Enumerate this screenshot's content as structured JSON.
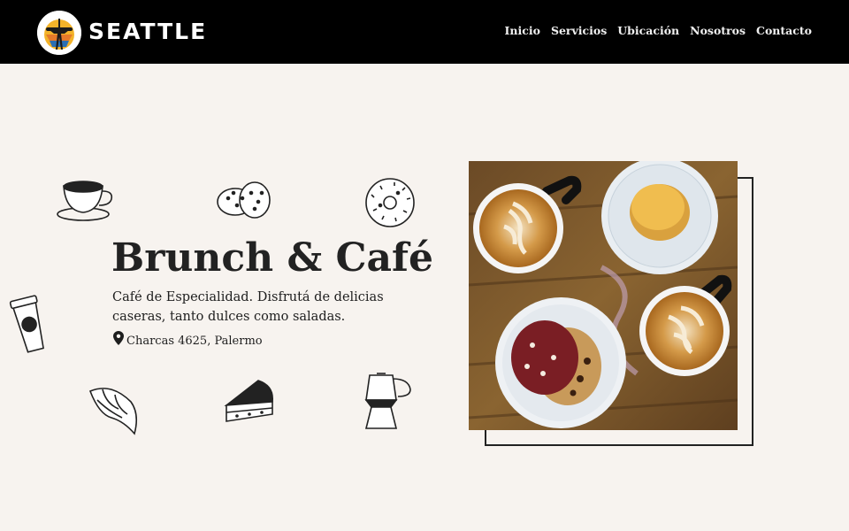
{
  "brand": {
    "name": "SEATTLE",
    "logo_icon": "space-needle-logo"
  },
  "nav": {
    "items": [
      {
        "label": "Inicio"
      },
      {
        "label": "Servicios"
      },
      {
        "label": "Ubicación"
      },
      {
        "label": "Nosotros"
      },
      {
        "label": "Contacto"
      }
    ]
  },
  "hero": {
    "title": "Brunch & Café",
    "description": "Café de Especialidad. Disfrutá de delicias caseras, tanto dulces como saladas.",
    "address": "Charcas 4625, Palermo",
    "address_icon": "map-pin-icon",
    "image_description_icons": [
      "coffee-cup-icon",
      "cookies-icon",
      "donut-icon",
      "to-go-cup-icon",
      "croissant-icon",
      "cake-slice-icon",
      "moka-pot-icon"
    ]
  },
  "colors": {
    "background": "#f7f3ef",
    "navbar": "#000000",
    "text": "#1e1e1e",
    "nav_text": "#f0f0f0"
  }
}
